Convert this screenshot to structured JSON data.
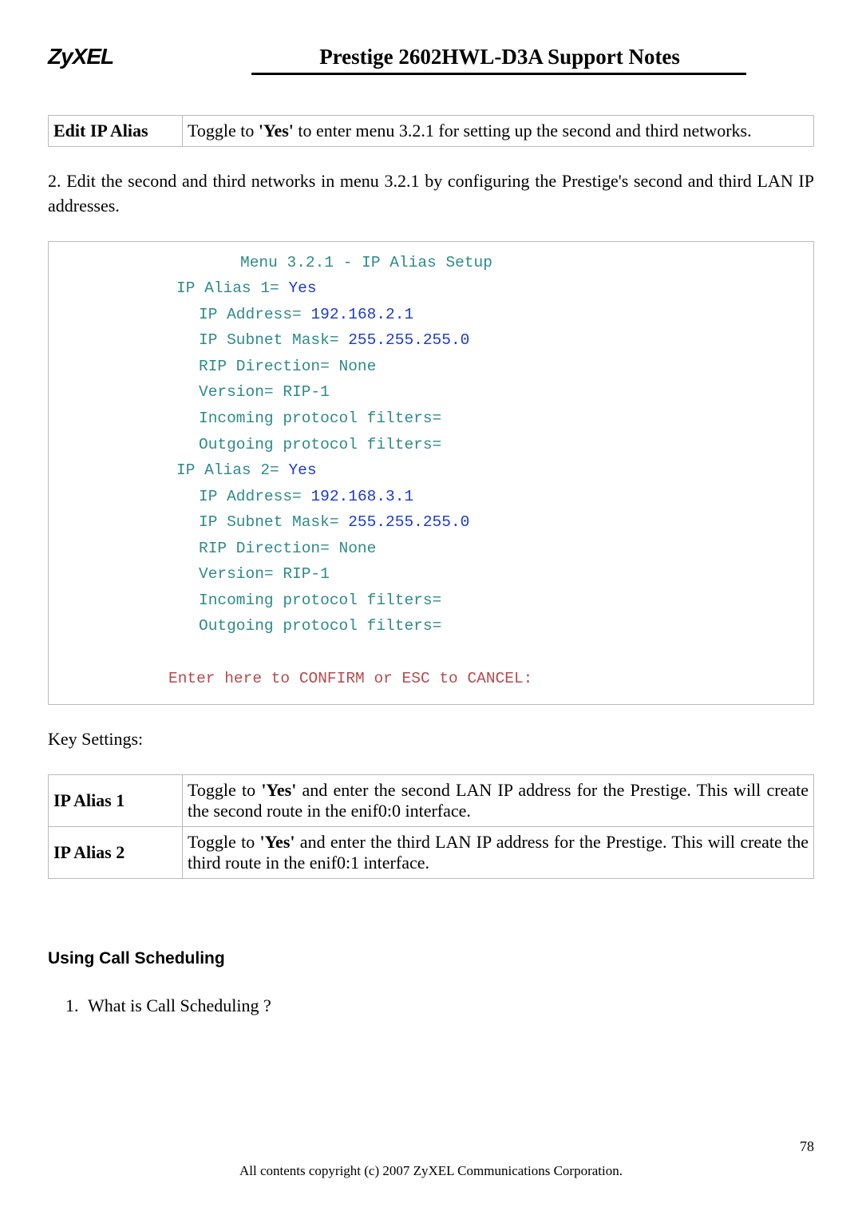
{
  "header": {
    "logo": "ZyXEL",
    "title": "Prestige 2602HWL-D3A Support Notes"
  },
  "table1": {
    "row": {
      "key": "Edit IP Alias",
      "pre": "Toggle to ",
      "bold": "'Yes'",
      "post": " to enter menu 3.2.1 for setting up the second and third networks."
    }
  },
  "para1": "2. Edit the second and third networks in menu 3.2.1 by configuring the Prestige's second and third LAN IP addresses.",
  "term": {
    "title": "Menu 3.2.1 - IP Alias Setup",
    "alias1_label": "IP Alias 1= ",
    "alias1_val": "Yes",
    "ip1_label": "IP Address= ",
    "ip1_val": "192.168.2.1",
    "mask1_label": "IP Subnet Mask= ",
    "mask1_val": "255.255.255.0",
    "rip1": "RIP Direction= None",
    "ver1": "Version= RIP-1",
    "in1": "Incoming protocol filters=",
    "out1": "Outgoing protocol filters=",
    "alias2_label": "IP Alias 2= ",
    "alias2_val": "Yes",
    "ip2_label": "IP Address= ",
    "ip2_val": "192.168.3.1",
    "mask2_label": "IP Subnet Mask= ",
    "mask2_val": "255.255.255.0",
    "rip2": "RIP Direction= None",
    "ver2": "Version= RIP-1",
    "in2": "Incoming protocol filters=",
    "out2": "Outgoing protocol filters=",
    "confirm": "Enter here to CONFIRM or ESC to CANCEL:"
  },
  "keysettings_label": "Key Settings:",
  "table2": {
    "r1": {
      "key": "IP Alias 1",
      "pre": "Toggle to ",
      "bold": "'Yes'",
      "post": " and enter the second LAN IP address for the Prestige. This will create the second route in the enif0:0 interface."
    },
    "r2": {
      "key": "IP Alias 2",
      "pre": "Toggle to ",
      "bold": "'Yes'",
      "post": " and enter the third LAN IP address for the Prestige. This will create the third route in the enif0:1 interface."
    }
  },
  "section": "Using Call Scheduling",
  "listitem1": "What is Call Scheduling ?",
  "footer": "All contents copyright (c) 2007 ZyXEL Communications Corporation.",
  "pagenum": "78"
}
